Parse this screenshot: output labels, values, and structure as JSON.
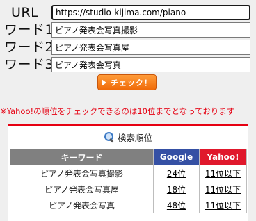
{
  "form": {
    "url_label": "URL",
    "url_value": "https://studio-kijima.com/piano",
    "word1_label": "ワード1",
    "word1_value": "ピアノ発表会写真撮影",
    "word2_label": "ワード2",
    "word2_value": "ピアノ発表会写真屋",
    "word3_label": "ワード3",
    "word3_value": "ピアノ発表会写真",
    "check_button_label": "チェック！"
  },
  "notice": "※Yahoo!の順位をチェックできるのは10位までとなっております",
  "results": {
    "title": "検索順位",
    "headers": {
      "keyword": "キーワード",
      "google": "Google",
      "yahoo": "Yahoo!"
    },
    "rows": [
      {
        "keyword": "ピアノ発表会写真撮影",
        "google": "24位",
        "yahoo": "11位以下"
      },
      {
        "keyword": "ピアノ発表会写真屋",
        "google": "18位",
        "yahoo": "11位以下"
      },
      {
        "keyword": "ピアノ発表会写真",
        "google": "48位",
        "yahoo": "11位以下"
      }
    ]
  },
  "colors": {
    "accent": "#e60012",
    "google": "#3550a4",
    "yahoo": "#e0182c",
    "button": "#f06b09"
  },
  "icons": {
    "title_icon": "search-icon",
    "button_icon": "play-icon"
  }
}
